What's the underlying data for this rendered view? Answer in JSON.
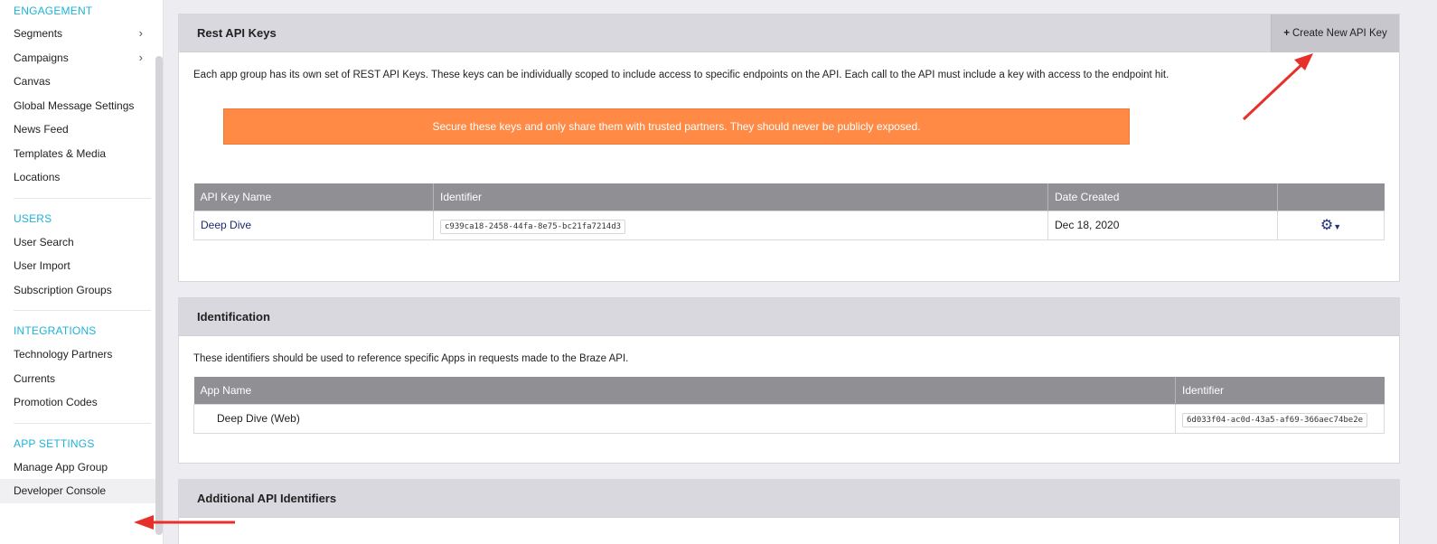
{
  "sidebar": {
    "sections": [
      {
        "heading": "ENGAGEMENT",
        "items": [
          {
            "label": "Segments",
            "chevron": true
          },
          {
            "label": "Campaigns",
            "chevron": true
          },
          {
            "label": "Canvas"
          },
          {
            "label": "Global Message Settings"
          },
          {
            "label": "News Feed"
          },
          {
            "label": "Templates & Media"
          },
          {
            "label": "Locations"
          }
        ]
      },
      {
        "heading": "USERS",
        "items": [
          {
            "label": "User Search"
          },
          {
            "label": "User Import"
          },
          {
            "label": "Subscription Groups"
          }
        ]
      },
      {
        "heading": "INTEGRATIONS",
        "items": [
          {
            "label": "Technology Partners"
          },
          {
            "label": "Currents"
          },
          {
            "label": "Promotion Codes"
          }
        ]
      },
      {
        "heading": "APP SETTINGS",
        "items": [
          {
            "label": "Manage App Group"
          },
          {
            "label": "Developer Console",
            "active": true
          }
        ]
      }
    ]
  },
  "rest_api": {
    "title": "Rest API Keys",
    "create_button": "Create New API Key",
    "description": "Each app group has its own set of REST API Keys. These keys can be individually scoped to include access to specific endpoints on the API. Each call to the API must include a key with access to the endpoint hit.",
    "warning": "Secure these keys and only share them with trusted partners. They should never be publicly exposed.",
    "columns": [
      "API Key Name",
      "Identifier",
      "Date Created",
      ""
    ],
    "rows": [
      {
        "name": "Deep Dive",
        "identifier": "c939ca18-2458-44fa-8e75-bc21fa7214d3",
        "date": "Dec 18, 2020"
      }
    ]
  },
  "identification": {
    "title": "Identification",
    "description": "These identifiers should be used to reference specific Apps in requests made to the Braze API.",
    "columns": [
      "App Name",
      "Identifier"
    ],
    "rows": [
      {
        "name": "Deep Dive (Web)",
        "identifier": "6d033f04-ac0d-43a5-af69-366aec74be2e"
      }
    ]
  },
  "additional": {
    "title": "Additional API Identifiers"
  },
  "colors": {
    "accent": "#1fb2d6",
    "warning": "#ff8a45",
    "annotation_arrow": "#e8302a"
  }
}
